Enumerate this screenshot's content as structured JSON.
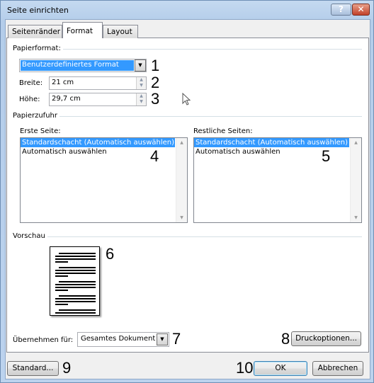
{
  "window": {
    "title": "Seite einrichten",
    "help_icon": "question-icon",
    "close_icon": "close-icon"
  },
  "tabs": [
    {
      "label": "Seitenränder",
      "active": false
    },
    {
      "label": "Format",
      "active": true
    },
    {
      "label": "Layout",
      "active": false
    }
  ],
  "paper_format": {
    "group_label": "Papierformat:",
    "selected": "Benutzerdefiniertes Format",
    "width_label": "Breite:",
    "width_value": "21 cm",
    "height_label": "Höhe:",
    "height_value": "29,7 cm"
  },
  "paper_source": {
    "group_label": "Papierzufuhr",
    "first_page_label": "Erste Seite:",
    "other_pages_label": "Restliche Seiten:",
    "first_page_items": [
      "Standardschacht (Automatisch auswählen)",
      "Automatisch auswählen"
    ],
    "other_pages_items": [
      "Standardschacht (Automatisch auswählen)",
      "Automatisch auswählen"
    ],
    "selected_index": 0
  },
  "preview": {
    "group_label": "Vorschau"
  },
  "apply": {
    "label": "Übernehmen für:",
    "selected": "Gesamtes Dokument"
  },
  "buttons": {
    "print_options": "Druckoptionen...",
    "default": "Standard...",
    "ok": "OK",
    "cancel": "Abbrechen"
  },
  "annotations": [
    "1",
    "2",
    "3",
    "4",
    "5",
    "6",
    "7",
    "8",
    "9",
    "10"
  ],
  "colors": {
    "selection": "#3399ff",
    "titlebar": "#bcd3ee"
  }
}
